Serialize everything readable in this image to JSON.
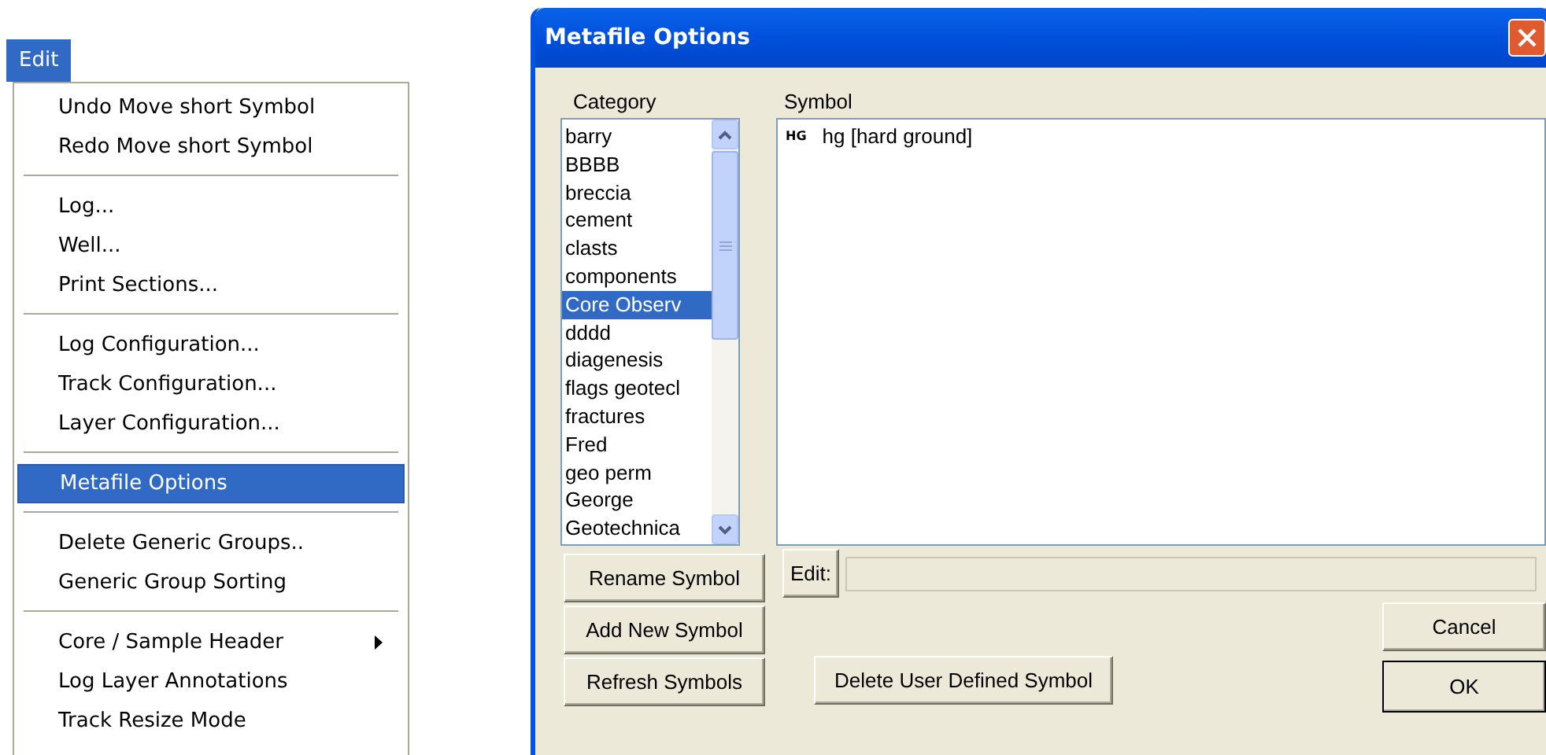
{
  "menu_bar": {
    "items": [
      {
        "label": "Edit",
        "selected": true
      }
    ]
  },
  "edit_menu": {
    "groups": [
      [
        {
          "label": "Undo Move short Symbol",
          "selected": false,
          "submenu": false
        },
        {
          "label": "Redo Move short Symbol",
          "selected": false,
          "submenu": false
        }
      ],
      [
        {
          "label": "Log...",
          "selected": false,
          "submenu": false
        },
        {
          "label": "Well...",
          "selected": false,
          "submenu": false
        },
        {
          "label": "Print Sections...",
          "selected": false,
          "submenu": false
        }
      ],
      [
        {
          "label": "Log Configuration...",
          "selected": false,
          "submenu": false
        },
        {
          "label": "Track Configuration...",
          "selected": false,
          "submenu": false
        },
        {
          "label": "Layer Configuration...",
          "selected": false,
          "submenu": false
        }
      ],
      [
        {
          "label": "Metafile Options",
          "selected": true,
          "submenu": false
        }
      ],
      [
        {
          "label": "Delete Generic Groups..",
          "selected": false,
          "submenu": false
        },
        {
          "label": "Generic Group Sorting",
          "selected": false,
          "submenu": false
        }
      ],
      [
        {
          "label": "Core / Sample Header",
          "selected": false,
          "submenu": true
        },
        {
          "label": "Log Layer Annotations",
          "selected": false,
          "submenu": false
        },
        {
          "label": "Track Resize Mode",
          "selected": false,
          "submenu": false
        }
      ]
    ]
  },
  "dialog": {
    "title": "Metafile Options",
    "category": {
      "label": "Category",
      "items": [
        {
          "label": "barry",
          "selected": false
        },
        {
          "label": "BBBB",
          "selected": false
        },
        {
          "label": "breccia",
          "selected": false
        },
        {
          "label": "cement",
          "selected": false
        },
        {
          "label": "clasts",
          "selected": false
        },
        {
          "label": "components",
          "selected": false
        },
        {
          "label": "Core Observ",
          "selected": true
        },
        {
          "label": "dddd",
          "selected": false
        },
        {
          "label": "diagenesis",
          "selected": false
        },
        {
          "label": "flags geotecl",
          "selected": false
        },
        {
          "label": "fractures",
          "selected": false
        },
        {
          "label": "Fred",
          "selected": false
        },
        {
          "label": "geo perm",
          "selected": false
        },
        {
          "label": "George",
          "selected": false
        },
        {
          "label": "Geotechnica",
          "selected": false
        }
      ]
    },
    "symbol": {
      "label": "Symbol",
      "items": [
        {
          "glyph": "HG",
          "label": "hg [hard ground]",
          "selected": false
        }
      ]
    },
    "edit_button": "Edit:",
    "left_buttons": [
      "Rename Symbol",
      "Add New Symbol",
      "Refresh Symbols"
    ],
    "delete_button": "Delete User Defined Symbol",
    "cancel_button": "Cancel",
    "ok_button": "OK"
  }
}
